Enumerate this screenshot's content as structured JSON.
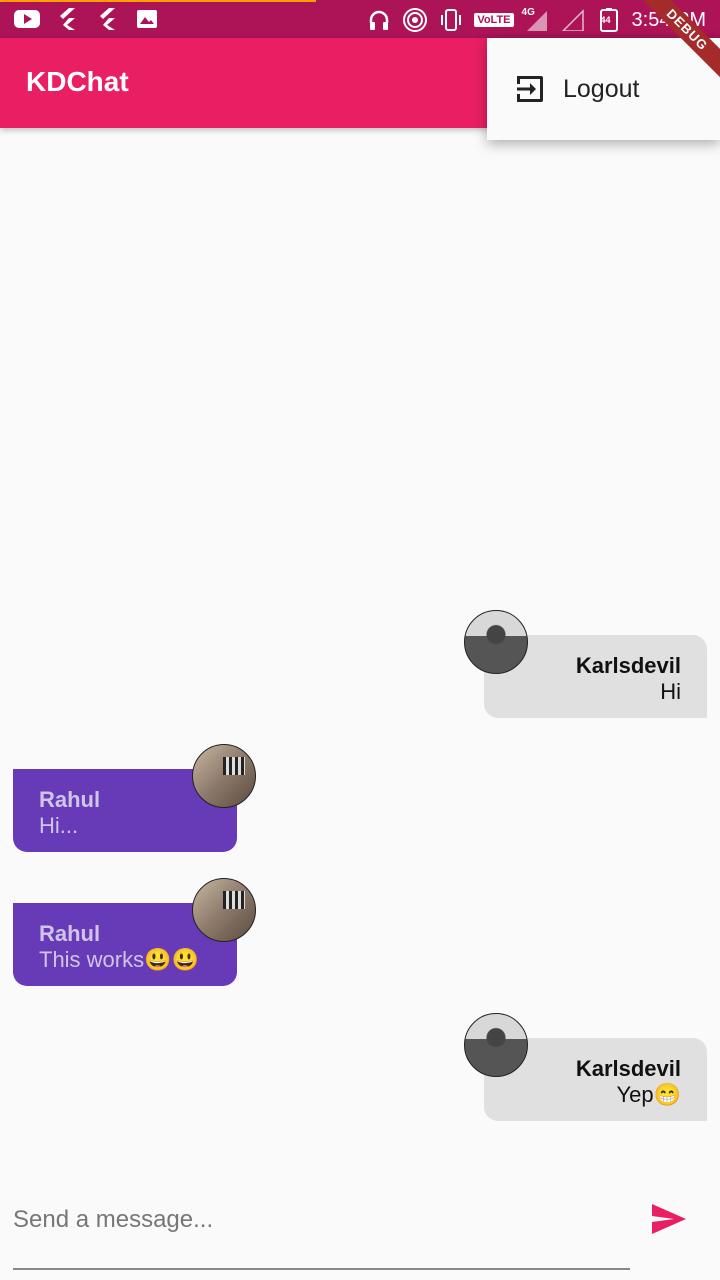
{
  "status_bar": {
    "time": "3:54 PM",
    "volte": "VoLTE",
    "network": "4G",
    "battery": "44",
    "left_icons": [
      "youtube-icon",
      "flutter-icon",
      "flutter-icon",
      "image-icon"
    ],
    "right_icons": [
      "headphones-icon",
      "hotspot-icon",
      "vibrate-icon",
      "signal-icon",
      "battery-icon"
    ]
  },
  "debug_banner": "DEBUG",
  "app_bar": {
    "title": "KDChat"
  },
  "menu": {
    "logout_label": "Logout"
  },
  "messages": [
    {
      "side": "right",
      "name": "Karlsdevil",
      "text": "Hi"
    },
    {
      "side": "left",
      "name": "Rahul",
      "text": "Hi..."
    },
    {
      "side": "left",
      "name": "Rahul",
      "text": "This works😃😃"
    },
    {
      "side": "right",
      "name": "Karlsdevil",
      "text": "Yep😁"
    }
  ],
  "composer": {
    "placeholder": "Send a message..."
  },
  "colors": {
    "primary": "#e91e63",
    "status_bar": "#ad1457",
    "left_bubble": "#673ab7",
    "right_bubble": "#e0e0e0"
  }
}
